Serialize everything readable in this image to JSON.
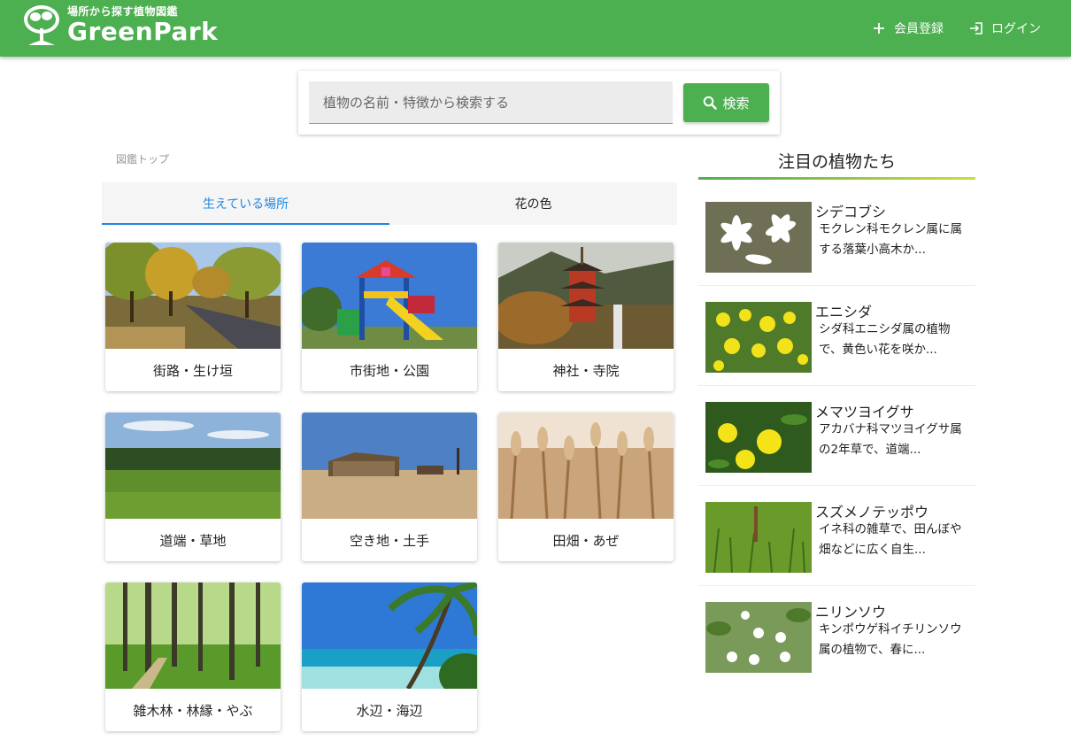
{
  "header": {
    "tagline": "場所から探す植物図鑑",
    "brand": "GreenPark",
    "nav": [
      {
        "icon": "plus-icon",
        "label": "会員登録"
      },
      {
        "icon": "login-icon",
        "label": "ログイン"
      }
    ]
  },
  "search": {
    "placeholder": "植物の名前・特徴から検索する",
    "button_label": "検索"
  },
  "breadcrumb": "図鑑トップ",
  "tabs": [
    {
      "label": "生えている場所",
      "active": true
    },
    {
      "label": "花の色",
      "active": false
    }
  ],
  "places": [
    {
      "label": "街路・生け垣"
    },
    {
      "label": "市街地・公園"
    },
    {
      "label": "神社・寺院"
    },
    {
      "label": "道端・草地"
    },
    {
      "label": "空き地・土手"
    },
    {
      "label": "田畑・あぜ"
    },
    {
      "label": "雑木林・林縁・やぶ"
    },
    {
      "label": "水辺・海辺"
    }
  ],
  "sidebar": {
    "title": "注目の植物たち",
    "items": [
      {
        "name": "シデコブシ",
        "desc": "モクレン科モクレン属に属する落葉小高木か..."
      },
      {
        "name": "エニシダ",
        "desc": "シダ科エニシダ属の植物で、黄色い花を咲か..."
      },
      {
        "name": "メマツヨイグサ",
        "desc": "アカバナ科マツヨイグサ属の2年草で、道端..."
      },
      {
        "name": "スズメノテッポウ",
        "desc": "イネ科の雑草で、田んぼや畑などに広く自生..."
      },
      {
        "name": "ニリンソウ",
        "desc": "キンポウゲ科イチリンソウ属の植物で、春に..."
      }
    ]
  },
  "colors": {
    "brand": "#4caf50",
    "active_tab": "#1e88e5"
  }
}
